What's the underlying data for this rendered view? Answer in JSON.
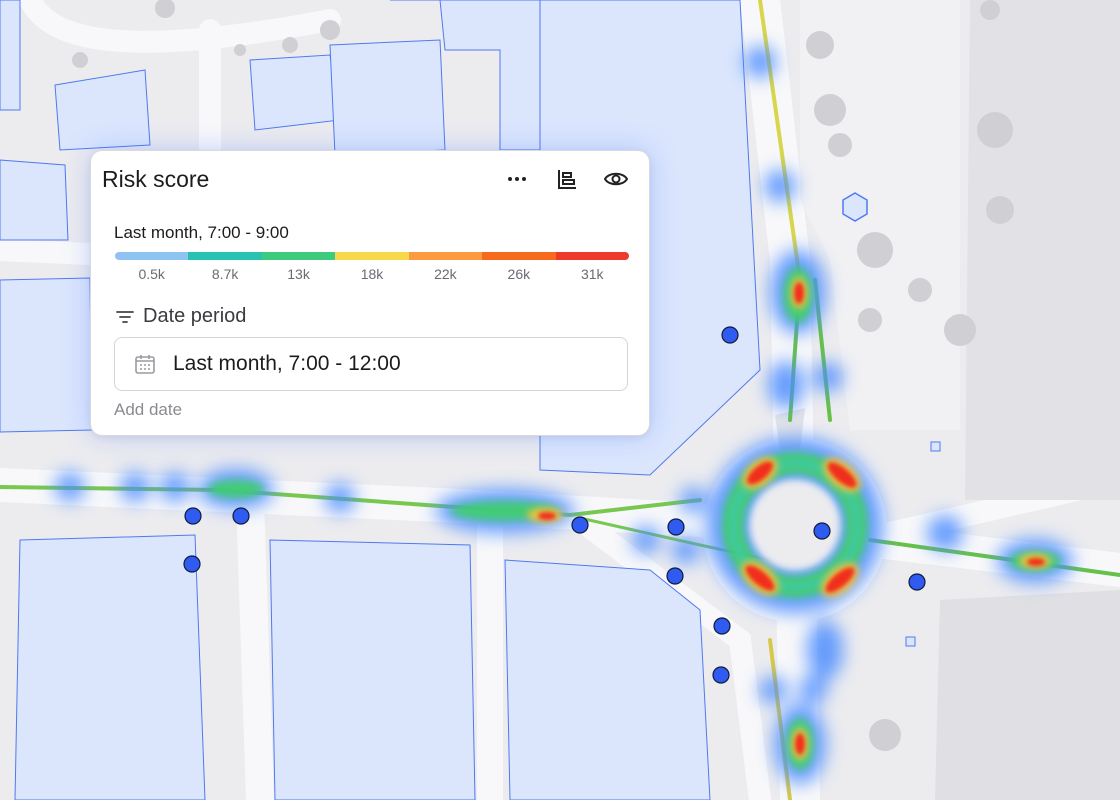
{
  "panel": {
    "title": "Risk score",
    "actions": [
      {
        "icon": "more-horizontal-icon"
      },
      {
        "icon": "chart-bars-icon"
      },
      {
        "icon": "eye-icon"
      }
    ],
    "legend": {
      "title": "Last month, 7:00 - 9:00",
      "ticks": [
        "0.5k",
        "8.7k",
        "13k",
        "18k",
        "22k",
        "26k",
        "31k"
      ],
      "colors": [
        "#8ec3f2",
        "#27c2b2",
        "#3fcb7d",
        "#f8d94c",
        "#fb9a3e",
        "#f66a1e",
        "#ee3a2e"
      ]
    },
    "date_period": {
      "label": "Date period",
      "icon": "filter-lines-icon",
      "value": "Last month, 7:00 - 12:00",
      "value_icon": "calendar-icon",
      "add_label": "Add date"
    }
  },
  "map": {
    "colors": {
      "background": "#ececef",
      "road": "#f8f8fa",
      "building": "#dbe6fd",
      "building_stroke": "#4f79f0",
      "point": "#2f5bf0",
      "heat_low": "#4b8cff",
      "heat_mid": "#3fd06b",
      "heat_high": "#f02d1a"
    }
  }
}
